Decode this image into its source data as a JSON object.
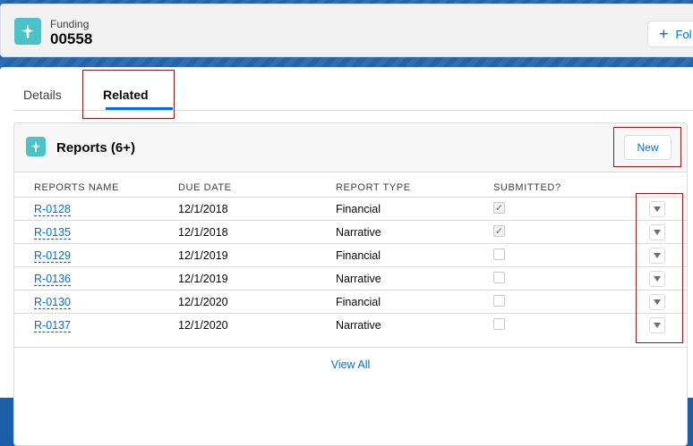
{
  "header": {
    "object_label": "Funding",
    "record_name": "00558",
    "follow_label": "Fol",
    "icon": "funding-icon"
  },
  "tabs": [
    {
      "label": "Details",
      "active": false
    },
    {
      "label": "Related",
      "active": true
    }
  ],
  "related": {
    "title": "Reports (6+)",
    "new_label": "New",
    "icon": "funding-icon",
    "columns": [
      "REPORTS NAME",
      "DUE DATE",
      "REPORT TYPE",
      "SUBMITTED?"
    ],
    "rows": [
      {
        "name": "R-0128",
        "due": "12/1/2018",
        "type": "Financial",
        "submitted": true
      },
      {
        "name": "R-0135",
        "due": "12/1/2018",
        "type": "Narrative",
        "submitted": true
      },
      {
        "name": "R-0129",
        "due": "12/1/2019",
        "type": "Financial",
        "submitted": false
      },
      {
        "name": "R-0136",
        "due": "12/1/2019",
        "type": "Narrative",
        "submitted": false
      },
      {
        "name": "R-0130",
        "due": "12/1/2020",
        "type": "Financial",
        "submitted": false
      },
      {
        "name": "R-0137",
        "due": "12/1/2020",
        "type": "Narrative",
        "submitted": false
      }
    ],
    "view_all_label": "View All"
  },
  "colors": {
    "brand": "#0070d2",
    "icon_bg": "#4ac3c8",
    "highlight": "#8b1a1a"
  }
}
